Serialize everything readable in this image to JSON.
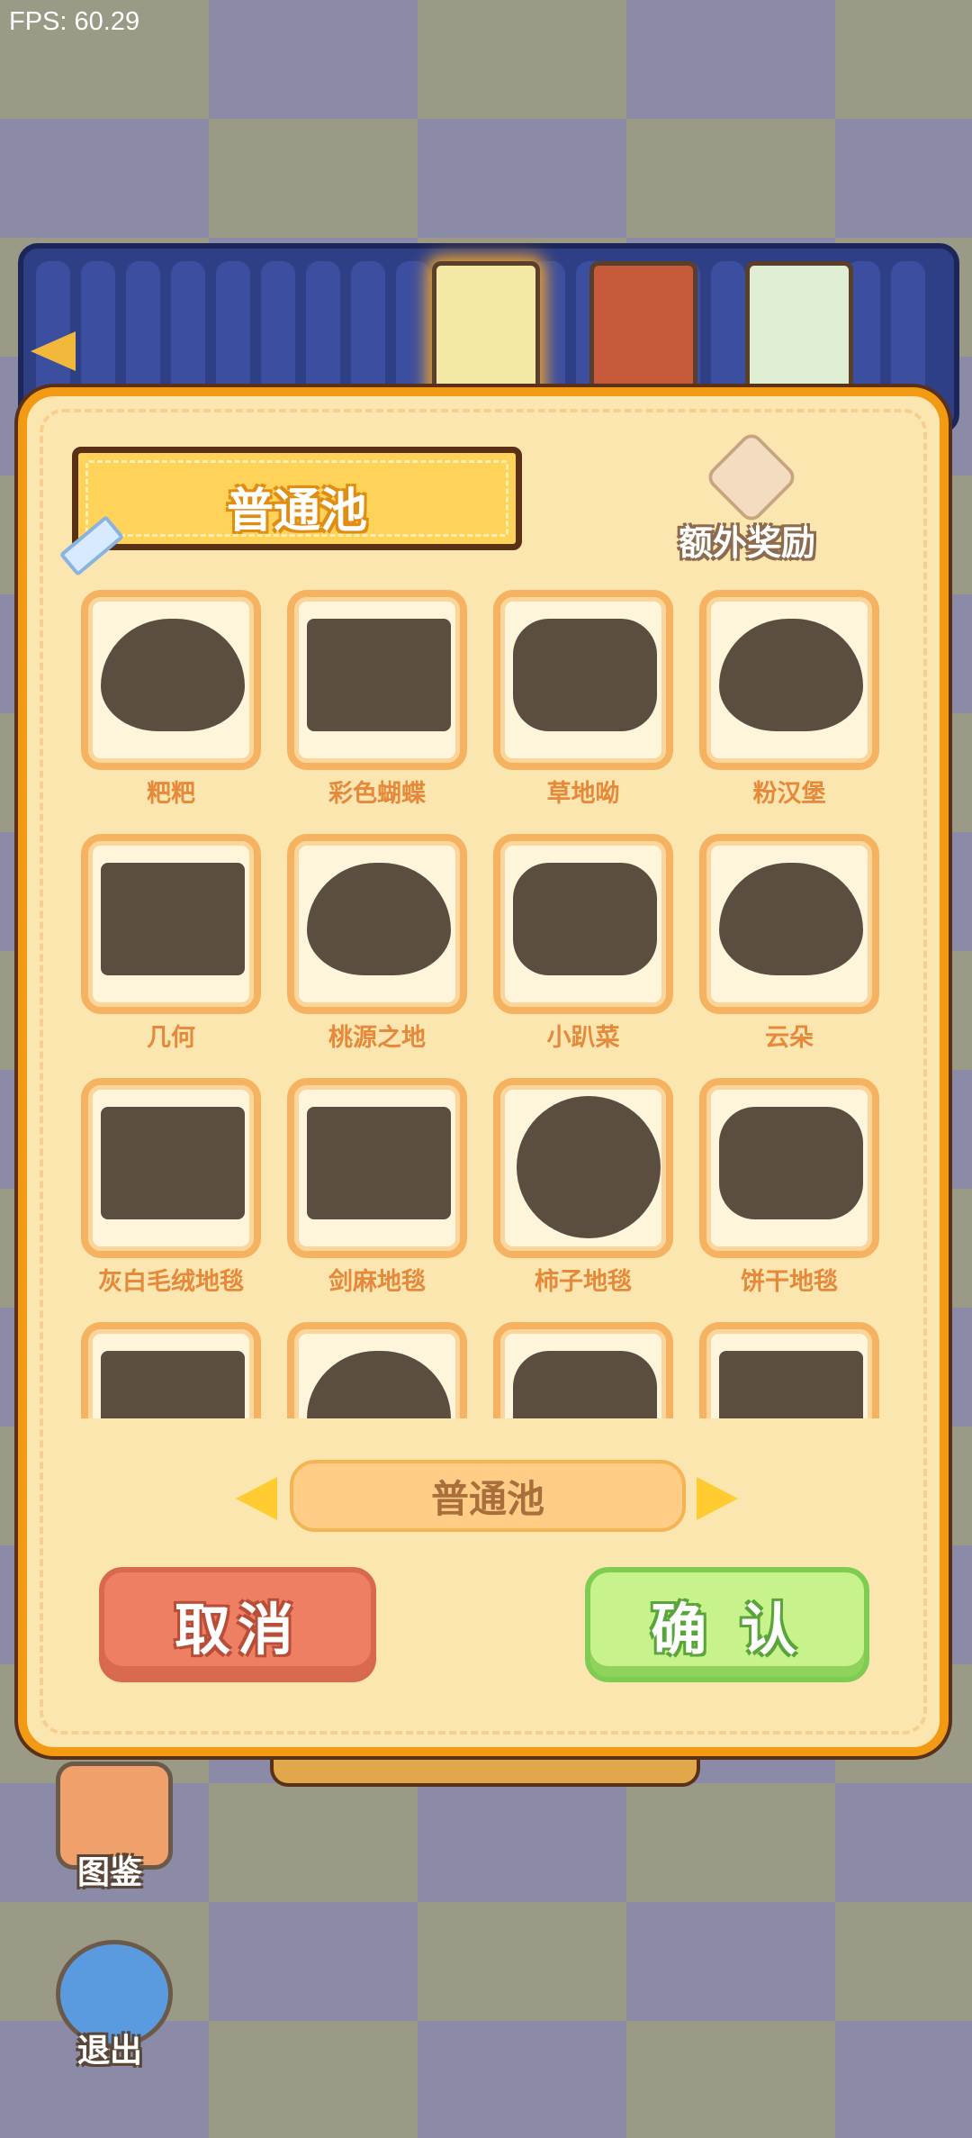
{
  "status": {
    "fps": "FPS: 60.29"
  },
  "panel": {
    "title": "普通池",
    "bonus_label": "额外奖励"
  },
  "items": [
    {
      "label": "粑粑",
      "shape": "blob"
    },
    {
      "label": "彩色蝴蝶",
      "shape": "rect"
    },
    {
      "label": "草地呦",
      "shape": "cloud"
    },
    {
      "label": "粉汉堡",
      "shape": "blob"
    },
    {
      "label": "几何",
      "shape": "rect"
    },
    {
      "label": "桃源之地",
      "shape": "blob"
    },
    {
      "label": "小趴菜",
      "shape": "cloud"
    },
    {
      "label": "云朵",
      "shape": "blob"
    },
    {
      "label": "灰白毛绒地毯",
      "shape": "rect"
    },
    {
      "label": "剑麻地毯",
      "shape": "rect"
    },
    {
      "label": "柿子地毯",
      "shape": "round"
    },
    {
      "label": "饼干地毯",
      "shape": "cloud"
    },
    {
      "label": "",
      "shape": "rect"
    },
    {
      "label": "",
      "shape": "blob"
    },
    {
      "label": "",
      "shape": "cloud"
    },
    {
      "label": "",
      "shape": "rect"
    }
  ],
  "pool_selector": {
    "current": "普通池"
  },
  "buttons": {
    "cancel": "取消",
    "confirm": "确 认"
  },
  "side_buttons": {
    "catalog": "图鉴",
    "exit": "退出"
  },
  "colors": {
    "panel_border": "#f39a14",
    "panel_bg": "#fbe6b0",
    "cancel": "#ee7f63",
    "confirm": "#c8f28b"
  }
}
